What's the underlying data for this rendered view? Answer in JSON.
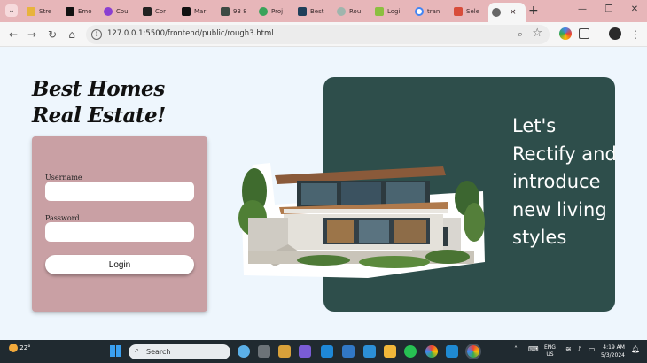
{
  "browser": {
    "tabs": [
      {
        "label": "Stre",
        "color": "#e8b33c"
      },
      {
        "label": "Emo",
        "color": "#111111"
      },
      {
        "label": "Cou",
        "color": "#8a3fd1"
      },
      {
        "label": "Cor",
        "color": "#222222"
      },
      {
        "label": "Mar",
        "color": "#111111"
      },
      {
        "label": "93 8",
        "color": "#3d4a44"
      },
      {
        "label": "Proj",
        "color": "#3aa35a"
      },
      {
        "label": "Best",
        "color": "#1f3f5a"
      },
      {
        "label": "Rou",
        "color": "#9fb5ad"
      },
      {
        "label": "Logi",
        "color": "#8bbf3f"
      },
      {
        "label": "tran",
        "color": "#ffffff"
      },
      {
        "label": "Sele",
        "color": "#d84c3a"
      }
    ],
    "active_tab_close": "×",
    "new_tab": "+",
    "url": "127.0.0.1:5500/frontend/public/rough3.html",
    "window_controls": {
      "minimize": "—",
      "restore": "❐",
      "close": "✕"
    }
  },
  "page": {
    "brand_title": "Best Homes Real Estate!",
    "login": {
      "username_label": "Username",
      "username_value": "",
      "password_label": "Password",
      "password_value": "",
      "button_label": "Login"
    },
    "tagline": "Let's Rectify and introduce new living styles",
    "colors": {
      "card_bg": "#c9a0a4",
      "panel_bg": "#2e4e4b",
      "page_bg": "#eef6fd"
    }
  },
  "taskbar": {
    "temperature": "22°",
    "search_placeholder": "Search",
    "language": "ENG",
    "region": "US",
    "time": "4:19 AM",
    "date": "5/3/2024"
  }
}
